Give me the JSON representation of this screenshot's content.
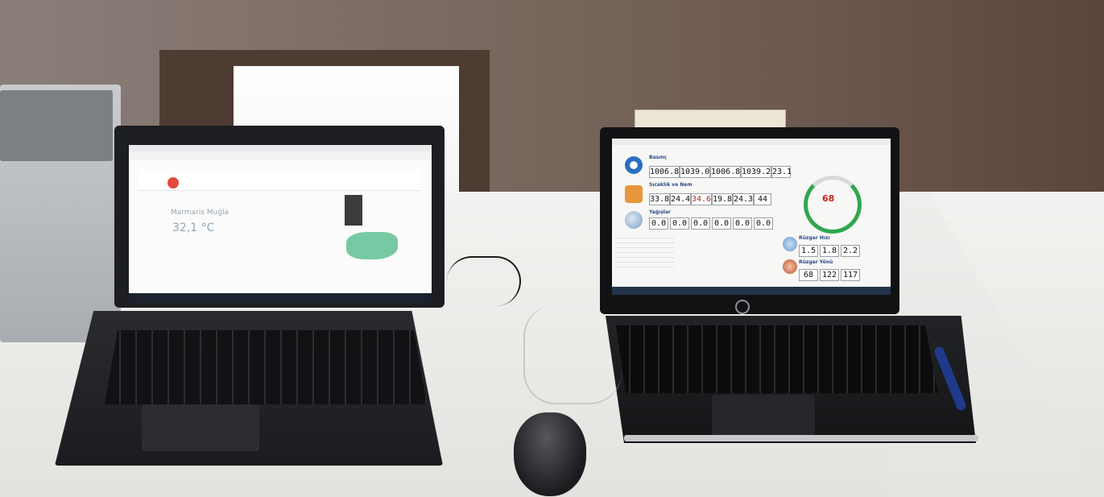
{
  "scene": "photo of two laptops on a desk",
  "colors": {
    "wall": "#7b6a61",
    "table": "#ececea",
    "laptop_body": "#1d1e21",
    "gauge_green": "#2fa84f",
    "gauge_red": "#c4281f",
    "map_green": "#5fbf93"
  },
  "left_laptop": {
    "screen": {
      "city": "Marmaris Muğla",
      "temperature": "32,1 °C"
    }
  },
  "right_laptop": {
    "screen": {
      "sections": {
        "pressure": "Basınç",
        "temp_humidity": "Sıcaklık ve Nem",
        "rain": "Yağışlar",
        "wind_dir": "Rüzgar Hızı",
        "wind_speed": "Rüzgar Yönü"
      },
      "pressure_values": [
        "1006.8",
        "1039.0",
        "1006.8",
        "1039.2",
        "23.1"
      ],
      "temp_values": [
        "33.8",
        "24.4",
        "34.6",
        "19.8",
        "24.3",
        "44"
      ],
      "rain_values": [
        "0.0",
        "0.0",
        "0.0",
        "0.0",
        "0.0",
        "0.0"
      ],
      "wind_values_1": [
        "1.5",
        "1.8",
        "2.2"
      ],
      "wind_values_2": [
        "68",
        "122",
        "117"
      ],
      "gauge_value": "68"
    },
    "brand_icon": "hp-logo-icon"
  }
}
